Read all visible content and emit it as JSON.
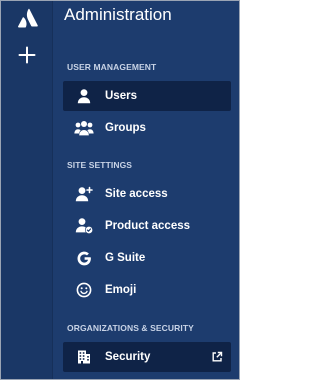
{
  "app": {
    "title": "Administration",
    "logo_icon": "atlassian-logo-icon",
    "create_icon": "plus-icon"
  },
  "colors": {
    "rail": "#1a3766",
    "panel": "#1d3c6e",
    "selected": "#0f2347",
    "text": "#ffffff",
    "section_text": "#c8d3e6"
  },
  "sections": [
    {
      "label": "USER MANAGEMENT",
      "items": [
        {
          "label": "Users",
          "icon": "user-icon",
          "selected": true
        },
        {
          "label": "Groups",
          "icon": "group-icon",
          "selected": false
        }
      ]
    },
    {
      "label": "SITE SETTINGS",
      "items": [
        {
          "label": "Site access",
          "icon": "user-add-icon",
          "selected": false
        },
        {
          "label": "Product access",
          "icon": "user-check-icon",
          "selected": false
        },
        {
          "label": "G Suite",
          "icon": "google-g-icon",
          "selected": false
        },
        {
          "label": "Emoji",
          "icon": "emoji-icon",
          "selected": false
        }
      ]
    },
    {
      "label": "ORGANIZATIONS & SECURITY",
      "items": [
        {
          "label": "Security",
          "icon": "building-icon",
          "selected": true,
          "trailing_icon": "external-link-icon"
        }
      ]
    }
  ]
}
